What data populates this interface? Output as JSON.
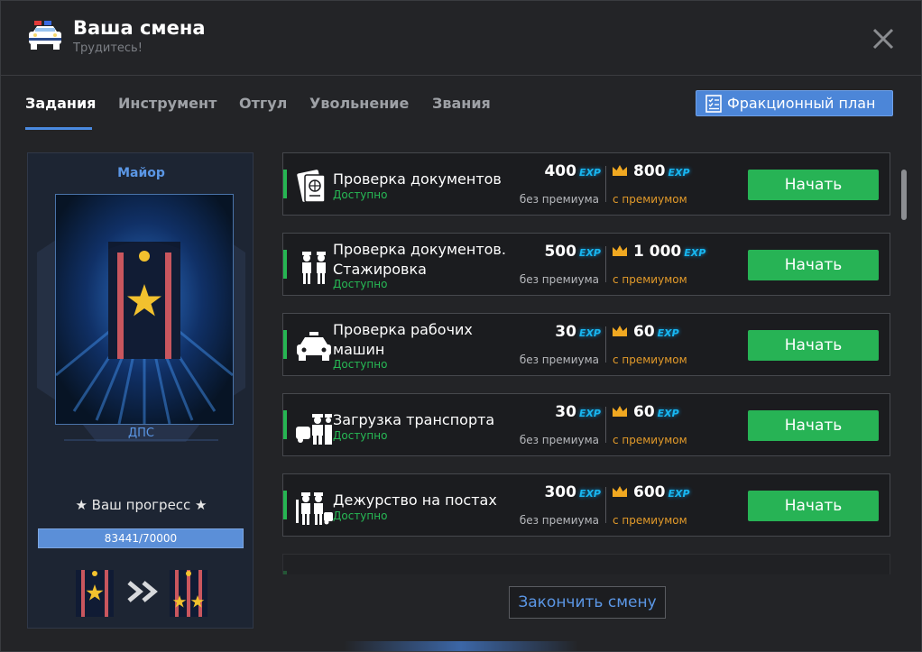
{
  "header": {
    "title": "Ваша смена",
    "subtitle": "Трудитесь!",
    "logo_icon": "police-car-icon",
    "close_icon": "close-icon"
  },
  "tabs": [
    {
      "label": "Задания",
      "active": true
    },
    {
      "label": "Инструмент",
      "active": false
    },
    {
      "label": "Отгул",
      "active": false
    },
    {
      "label": "Увольнение",
      "active": false
    },
    {
      "label": "Звания",
      "active": false
    }
  ],
  "plan_button": {
    "label": "Фракционный план",
    "icon": "checklist-icon"
  },
  "rank": {
    "title": "Майор",
    "department": "ДПС",
    "progress_label": "★ Ваш прогресс ★",
    "progress_text": "83441/70000",
    "progress_fraction": 1.0
  },
  "tasks": [
    {
      "name": "Проверка документов",
      "status": "Доступно",
      "exp": "400",
      "exp_premium": "800",
      "icon": "passport-icon"
    },
    {
      "name": "Проверка документов. Стажировка",
      "status": "Доступно",
      "exp": "500",
      "exp_premium": "1 000",
      "icon": "police-officers-icon"
    },
    {
      "name": "Проверка рабочих машин",
      "status": "Доступно",
      "exp": "30",
      "exp_premium": "60",
      "icon": "taxi-car-icon"
    },
    {
      "name": "Загрузка транспорта",
      "status": "Доступно",
      "exp": "30",
      "exp_premium": "60",
      "icon": "officer-car-icon"
    },
    {
      "name": "Дежурство на постах",
      "status": "Доступно",
      "exp": "300",
      "exp_premium": "600",
      "icon": "officers-post-icon"
    }
  ],
  "labels": {
    "exp_tag": "EXP",
    "no_premium": "без премиума",
    "with_premium": "с премиумом",
    "start": "Начать",
    "finish": "Закончить смену"
  },
  "colors": {
    "accent": "#4c86d8",
    "start_green": "#27b355",
    "available": "#27b955",
    "premium_orange": "#e29a2a",
    "exp_blue": "#18b6ef"
  }
}
